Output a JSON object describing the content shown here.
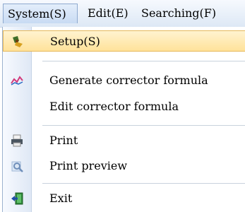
{
  "menubar": {
    "items": [
      {
        "label": "System(S)"
      },
      {
        "label": "Edit(E)"
      },
      {
        "label": "Searching(F)"
      }
    ]
  },
  "menu": {
    "items": [
      {
        "label": "Setup(S)",
        "icon": "setup-icon"
      },
      {
        "label": "Generate corrector formula",
        "icon": "chart-icon"
      },
      {
        "label": "Edit corrector formula",
        "icon": ""
      },
      {
        "label": "Print",
        "icon": "printer-icon"
      },
      {
        "label": "Print preview",
        "icon": "print-preview-icon"
      },
      {
        "label": "Exit",
        "icon": "exit-icon"
      }
    ]
  },
  "colors": {
    "highlight": "#ffe29a",
    "menubar": "#dde8f5"
  }
}
